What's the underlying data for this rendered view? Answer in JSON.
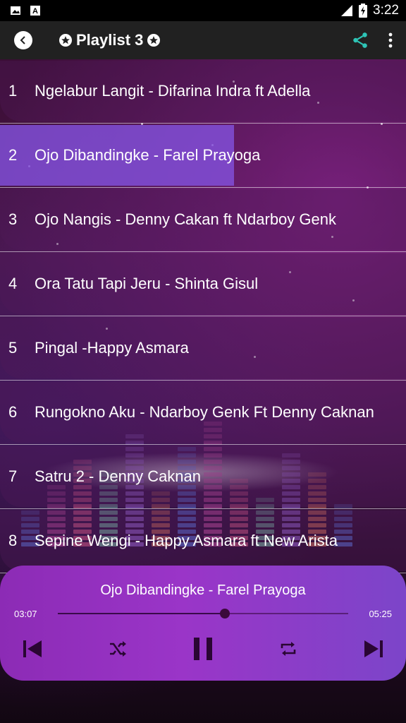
{
  "status_bar": {
    "time": "3:22"
  },
  "app_bar": {
    "title": "Playlist 3"
  },
  "playlist": [
    {
      "number": "1",
      "name": "Ngelabur Langit - Difarina Indra ft Adella"
    },
    {
      "number": "2",
      "name": "Ojo Dibandingke - Farel Prayoga"
    },
    {
      "number": "3",
      "name": "Ojo Nangis - Denny Cakan ft Ndarboy Genk"
    },
    {
      "number": "4",
      "name": "Ora Tatu Tapi Jeru - Shinta Gisul"
    },
    {
      "number": "5",
      "name": "Pingal -Happy Asmara"
    },
    {
      "number": "6",
      "name": "Rungokno Aku - Ndarboy Genk Ft Denny Caknan"
    },
    {
      "number": "7",
      "name": "Satru 2 - Denny Caknan"
    },
    {
      "number": "8",
      "name": "Sepine Wengi - Happy Asmara ft New Arista"
    }
  ],
  "player": {
    "now_playing": "Ojo Dibandingke - Farel Prayoga",
    "elapsed": "03:07",
    "duration": "05:25",
    "progress_fraction": 0.575,
    "icons": [
      "skip-previous-icon",
      "shuffle-icon",
      "pause-icon",
      "repeat-icon",
      "skip-next-icon"
    ]
  },
  "colors": {
    "active_row": "#8250dc",
    "share_accent": "#2ec4b6",
    "player_start": "#8c2bb5",
    "player_end": "#7c45c9"
  }
}
